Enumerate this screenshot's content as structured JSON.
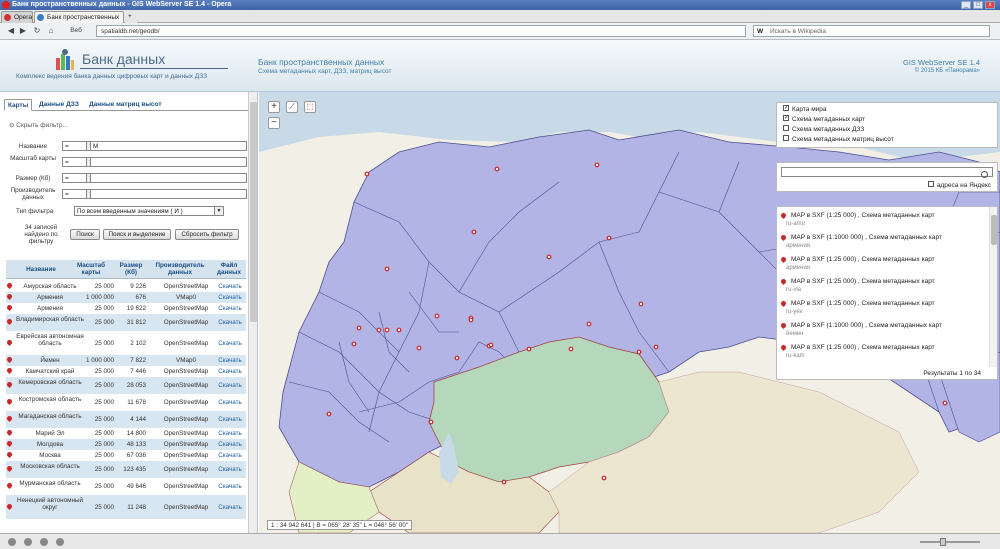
{
  "browser": {
    "window_title": "Банк пространственных данных - GIS WebServer SE 1.4 - Opera",
    "opera_tab": "Opera",
    "active_tab": "Банк пространственных данных",
    "back_label": "Веб",
    "url": "spatialdb.net/geodb/",
    "search_placeholder": "Искать в Wikipedia",
    "search_engine": "W"
  },
  "header": {
    "logo_title": "Банк данных",
    "logo_subtitle": "Комплекс ведения банка данных цифровых карт и данных ДЗЗ",
    "center_title": "Банк пространственных данных",
    "center_subtitle": "Схема метаданных карт, ДЗЗ, матриц высот",
    "product": "GIS WebServer SE 1.4",
    "copyright": "© 2015 КБ «Панорама»"
  },
  "left": {
    "tabs": [
      "Карты",
      "Данные ДЗЗ",
      "Данные матриц высот"
    ],
    "filter_toggle": "Скрыть фильтр...",
    "filter": [
      {
        "label": "Название",
        "op": "=",
        "value": "M"
      },
      {
        "label": "Масштаб карты",
        "op": "=",
        "value": ""
      },
      {
        "label": "Размер (Кб)",
        "op": "=",
        "value": ""
      },
      {
        "label": "Производитель данных",
        "op": "=",
        "value": ""
      }
    ],
    "filter_type_label": "Тип фильтра",
    "filter_type_value": "По всем введенным значениям ( И )",
    "found_text": "34 записей найдено по фильтру",
    "btn_search": "Поиск",
    "btn_search_select": "Поиск и выделение",
    "btn_reset": "Сбросить фильтр",
    "columns": [
      "Название",
      "Масштаб карты",
      "Размер (Кб)",
      "Производитель данных",
      "Файл данных"
    ],
    "rows": [
      {
        "name": "Амурская область",
        "scale": "25 000",
        "size": "9 226",
        "maker": "OpenStreetMap",
        "file": "Скачать"
      },
      {
        "name": "Армения",
        "scale": "1 000 000",
        "size": "676",
        "maker": "VMap0",
        "file": "Скачать"
      },
      {
        "name": "Армения",
        "scale": "25 000",
        "size": "19 622",
        "maker": "OpenStreetMap",
        "file": "Скачать"
      },
      {
        "name": "Владимирская область",
        "scale": "25 000",
        "size": "31 812",
        "maker": "OpenStreetMap",
        "file": "Скачать"
      },
      {
        "name": "Еврейская автономная область",
        "scale": "25 000",
        "size": "2 102",
        "maker": "OpenStreetMap",
        "file": "Скачать"
      },
      {
        "name": "Йемен",
        "scale": "1 000 000",
        "size": "7 822",
        "maker": "VMap0",
        "file": "Скачать"
      },
      {
        "name": "Камчатский край",
        "scale": "25 000",
        "size": "7 446",
        "maker": "OpenStreetMap",
        "file": "Скачать"
      },
      {
        "name": "Кемеровская область",
        "scale": "25 000",
        "size": "28 053",
        "maker": "OpenStreetMap",
        "file": "Скачать"
      },
      {
        "name": "Костромская область",
        "scale": "25 000",
        "size": "11 678",
        "maker": "OpenStreetMap",
        "file": "Скачать"
      },
      {
        "name": "Магаданская область",
        "scale": "25 000",
        "size": "4 144",
        "maker": "OpenStreetMap",
        "file": "Скачать"
      },
      {
        "name": "Марий Эл",
        "scale": "25 000",
        "size": "14 800",
        "maker": "OpenStreetMap",
        "file": "Скачать"
      },
      {
        "name": "Молдова",
        "scale": "25 000",
        "size": "48 133",
        "maker": "OpenStreetMap",
        "file": "Скачать"
      },
      {
        "name": "Москва",
        "scale": "25 000",
        "size": "67 036",
        "maker": "OpenStreetMap",
        "file": "Скачать"
      },
      {
        "name": "Московская область",
        "scale": "25 000",
        "size": "123 435",
        "maker": "OpenStreetMap",
        "file": "Скачать"
      },
      {
        "name": "Мурманская область",
        "scale": "25 000",
        "size": "49 646",
        "maker": "OpenStreetMap",
        "file": "Скачать"
      },
      {
        "name": "Ненецкий автономный округ",
        "scale": "25 000",
        "size": "11 248",
        "maker": "OpenStreetMap",
        "file": "Скачать"
      }
    ]
  },
  "map": {
    "layers": [
      {
        "label": "Карта мира",
        "checked": true
      },
      {
        "label": "Схема метаданных карт",
        "checked": true
      },
      {
        "label": "Схема метаданных ДЗЗ",
        "checked": false
      },
      {
        "label": "Схема метаданных матриц высот",
        "checked": false
      }
    ],
    "yandex_label": "адреса на Яндекс",
    "results": [
      {
        "title": "MAP в SXF (1:25 000) , Схема метаданных карт",
        "code": "ru-amu"
      },
      {
        "title": "MAP в SXF (1:1000 000) , Схема метаданных карт",
        "code": "армения"
      },
      {
        "title": "MAP в SXF (1:25 000) , Схема метаданных карт",
        "code": "армения"
      },
      {
        "title": "MAP в SXF (1:25 000) , Схема метаданных карт",
        "code": "ru-vla"
      },
      {
        "title": "MAP в SXF (1:25 000) , Схема метаданных карт",
        "code": "ru-yev"
      },
      {
        "title": "MAP в SXF (1:1000 000) , Схема метаданных карт",
        "code": "йемен"
      },
      {
        "title": "MAP в SXF (1:25 000) , Схема метаданных карт",
        "code": "ru-kam"
      }
    ],
    "results_count": "Результаты 1 по 34",
    "scale_readout": "1 : 34 942 641",
    "coords_readout": "B = 065° 28' 35\"  L = 046° 56' 00\""
  },
  "colors": {
    "russia_fill": "#b3b4e6",
    "kz_fill": "#b5d8bd",
    "sea": "#c8d9e8",
    "land": "#f2efe6",
    "marker": "#cc2626",
    "accent": "#1a4d87"
  }
}
